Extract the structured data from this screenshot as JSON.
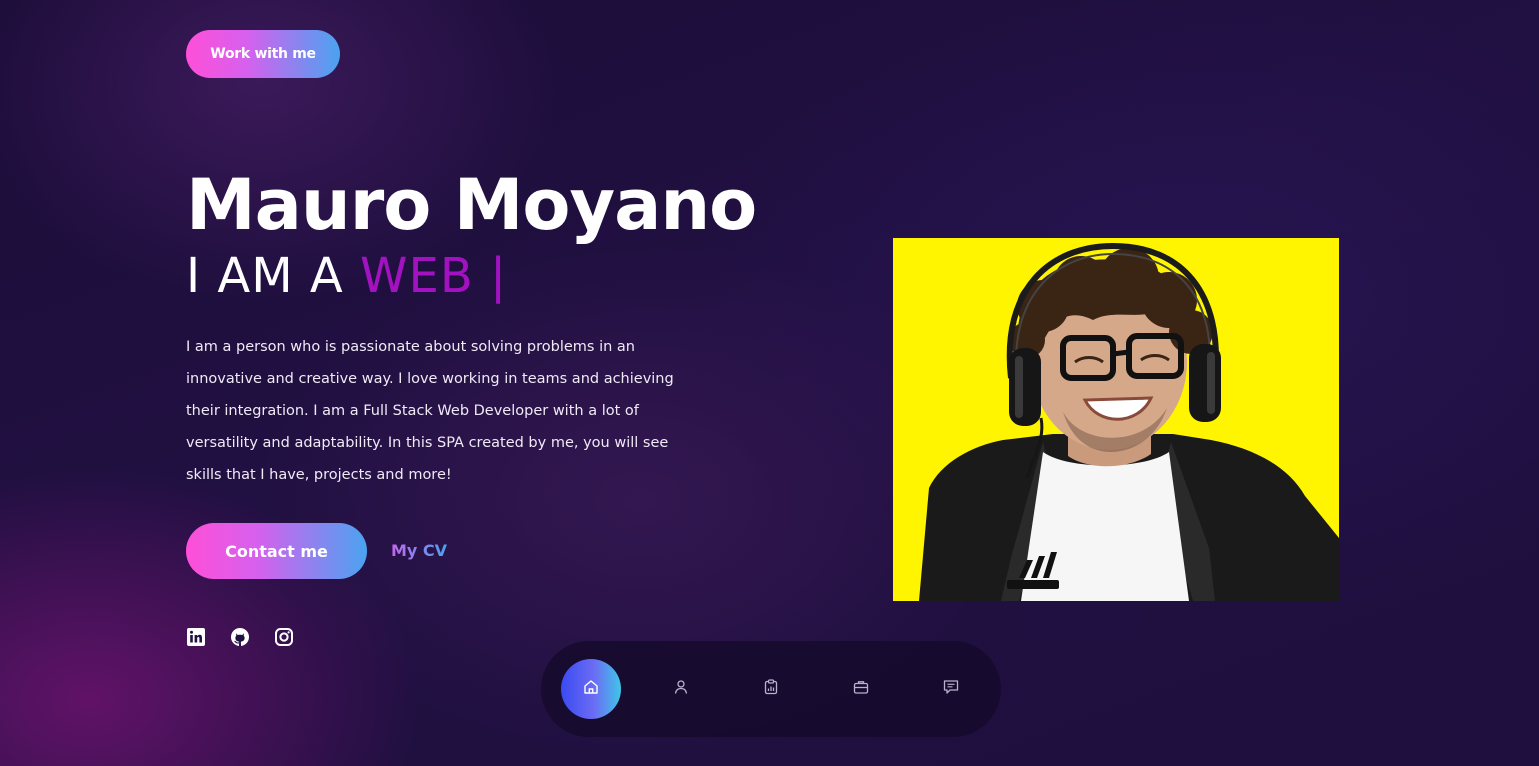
{
  "header": {
    "work_button_label": "Work with me"
  },
  "hero": {
    "name": "Mauro Moyano",
    "role_prefix": "I AM A",
    "role_word": "WEB",
    "cursor": "|",
    "bio": "I am a person who is passionate about solving problems in an innovative and creative way. I love working in teams and achieving their integration. I am a Full Stack Web Developer with a lot of versatility and adaptability. In this SPA created by me, you will see skills that I have, projects and more!",
    "contact_button_label": "Contact me",
    "cv_link_label": "My CV"
  },
  "social": [
    {
      "icon": "linkedin-icon"
    },
    {
      "icon": "github-icon"
    },
    {
      "icon": "instagram-icon"
    }
  ],
  "nav": {
    "items": [
      {
        "icon": "home-icon",
        "active": true
      },
      {
        "icon": "user-icon",
        "active": false
      },
      {
        "icon": "clipboard-chart-icon",
        "active": false
      },
      {
        "icon": "briefcase-icon",
        "active": false
      },
      {
        "icon": "message-icon",
        "active": false
      }
    ]
  },
  "colors": {
    "accent_pink": "#ff4fd8",
    "accent_blue": "#4aa3f0",
    "role_word": "#a312c0",
    "photo_background": "#fff500",
    "page_background": "#1e0f3e"
  }
}
